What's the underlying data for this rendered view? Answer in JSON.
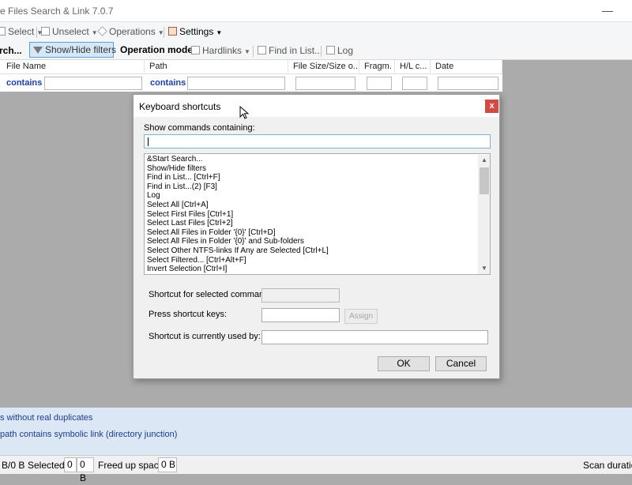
{
  "app": {
    "title": "e Files Search & Link 7.0.7",
    "minimize_glyph": "—"
  },
  "toolbar1": {
    "select": "Select",
    "unselect": "Unselect",
    "operations": "Operations",
    "settings": "Settings",
    "dropdown_glyph": "▼"
  },
  "toolbar2": {
    "search_partial": "rch...",
    "show_hide_filters": "Show/Hide filters",
    "operation_mode": "Operation mode:",
    "hardlinks": "Hardlinks",
    "find_in_list": "Find in List...",
    "log": "Log"
  },
  "columns": [
    "File Name",
    "Path",
    "File Size/Size o...",
    "Fragm.",
    "H/L c...",
    "Date"
  ],
  "filters": {
    "file_name_op": "contains",
    "path_op": "contains"
  },
  "status_lines": [
    "s without real duplicates",
    "path contains symbolic link (directory junction)"
  ],
  "bottom": {
    "size_partial": "B/0 B",
    "selected_label": "Selected:",
    "selected_count": "0",
    "selected_size": "0 B",
    "freed_label": "Freed up space:",
    "freed_value": "0 B",
    "scan_duration": "Scan duration"
  },
  "dialog": {
    "title": "Keyboard shortcuts",
    "close_glyph": "x",
    "show_commands_label": "Show commands containing:",
    "search_value": "",
    "commands": [
      "&Start Search...",
      "Show/Hide filters",
      "Find in List... [Ctrl+F]",
      "Find in List...(2) [F3]",
      "Log",
      "Select All [Ctrl+A]",
      "Select First Files [Ctrl+1]",
      "Select Last Files [Ctrl+2]",
      "Select All Files in Folder '{0}' [Ctrl+D]",
      "Select All Files in Folder '{0}' and Sub-folders",
      "Select Other NTFS-links If Any are Selected [Ctrl+L]",
      "Select Filtered... [Ctrl+Alt+F]",
      "Invert Selection [Ctrl+I]"
    ],
    "shortcut_selected_label": "Shortcut for selected command:",
    "press_keys_label": "Press shortcut keys:",
    "assign_button": "Assign",
    "used_by_label": "Shortcut is currently used by:",
    "ok_button": "OK",
    "cancel_button": "Cancel",
    "scroll_up_glyph": "▲",
    "scroll_down_glyph": "▼"
  },
  "colors": {
    "accent": "#5aa0d8",
    "close_red": "#d24b42",
    "filter_blue": "#1a3fb0",
    "status_blue": "#1d3c8f"
  }
}
